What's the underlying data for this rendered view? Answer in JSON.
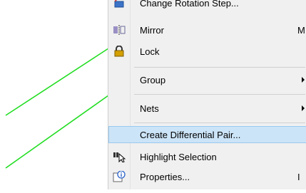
{
  "menu": {
    "items": [
      {
        "label": "Change Rotation Step...",
        "icon": "rotate-icon",
        "shortcut": ""
      },
      {
        "label": "Mirror",
        "icon": "mirror-icon",
        "shortcut": "M"
      },
      {
        "label": "Lock",
        "icon": "lock-icon",
        "shortcut": ""
      },
      {
        "label": "Group",
        "submenu": true
      },
      {
        "label": "Nets",
        "submenu": true
      },
      {
        "label": "Create Differential Pair...",
        "highlighted": true
      },
      {
        "label": "Highlight Selection",
        "icon": "highlight-selection-icon",
        "shortcut": ""
      },
      {
        "label": "Properties...",
        "icon": "properties-icon",
        "shortcut": "I"
      }
    ]
  },
  "colors": {
    "trace": "#22dd22",
    "highlight_bg": "#cce4f7",
    "highlight_border": "#99c9ef",
    "lock_icon": "#d4a000"
  }
}
